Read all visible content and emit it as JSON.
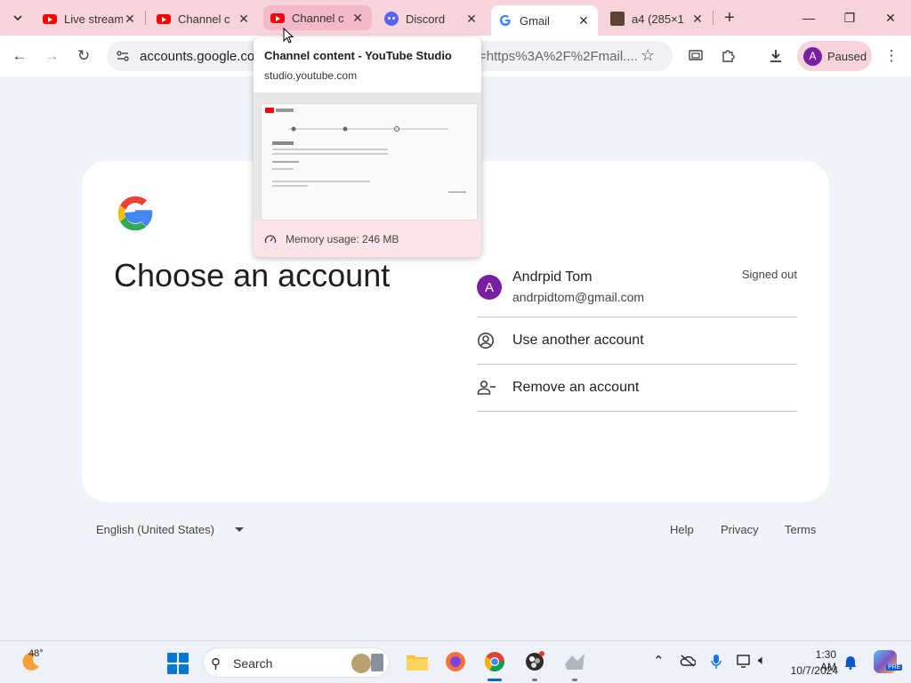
{
  "tabs": [
    {
      "title": "Live stream",
      "favicon": "youtube-icon"
    },
    {
      "title": "Channel c",
      "favicon": "youtube-icon"
    },
    {
      "title": "Channel c",
      "favicon": "youtube-icon",
      "state": "hover"
    },
    {
      "title": "Discord",
      "favicon": "discord-icon"
    },
    {
      "title": "Gmail",
      "favicon": "google-icon",
      "state": "active"
    },
    {
      "title": "a4 (285×1",
      "favicon": "image-icon"
    }
  ],
  "toolbar": {
    "url_host": "accounts.google.com",
    "url_rest": "=https%3A%2F%2Fmail....",
    "profile_initial": "A",
    "profile_status": "Paused"
  },
  "hovercard": {
    "title": "Channel content - YouTube Studio",
    "url": "studio.youtube.com",
    "memory": "Memory usage: 246 MB"
  },
  "page": {
    "title": "Choose an account"
  },
  "account": {
    "initial": "A",
    "name": "Andrpid Tom",
    "email": "andrpidtom@gmail.com",
    "status": "Signed out"
  },
  "options": [
    {
      "label": "Use another account",
      "icon": "account-circle-icon"
    },
    {
      "label": "Remove an account",
      "icon": "person-remove-icon"
    }
  ],
  "footer": {
    "language": "English (United States)",
    "links": [
      "Help",
      "Privacy",
      "Terms"
    ]
  },
  "taskbar": {
    "temperature": "48°",
    "search_label": "Search",
    "time": "1:30 AM",
    "date": "10/7/2024"
  },
  "colors": {
    "tabstrip": "#f7d4dc",
    "avatar": "#7b1fa2",
    "google_blue": "#4285f4",
    "google_red": "#ea4335",
    "google_yellow": "#fbbc05",
    "google_green": "#34a853"
  }
}
